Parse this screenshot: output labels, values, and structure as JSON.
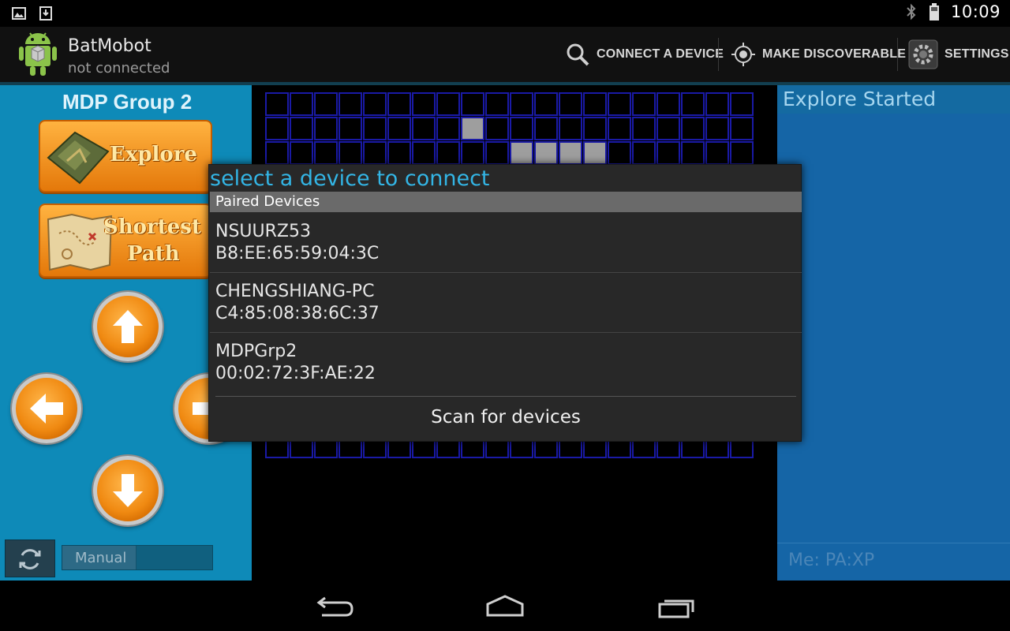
{
  "status_bar": {
    "clock": "10:09",
    "left_icons": [
      "gallery-notification-icon",
      "download-notification-icon"
    ],
    "right_icons": [
      "bluetooth-icon",
      "battery-icon"
    ]
  },
  "action_bar": {
    "title": "BatMobot",
    "subtitle": "not connected",
    "actions": {
      "connect": "CONNECT A DEVICE",
      "discoverable": "MAKE DISCOVERABLE",
      "settings": "SETTINGS"
    }
  },
  "left_panel": {
    "group_title": "MDP Group 2",
    "explore_label": "Explore",
    "shortest_label_line1": "Shortest",
    "shortest_label_line2": "Path",
    "mode_toggle_label": "Manual"
  },
  "maze": {
    "columns": 20,
    "visible_rows": 3,
    "explored_cells": [
      [
        1,
        8
      ],
      [
        2,
        10
      ],
      [
        2,
        11
      ],
      [
        2,
        12
      ],
      [
        2,
        13
      ]
    ],
    "cell_color_explored": "#9e9e9e",
    "grid_line_color": "#1a1aa6"
  },
  "right_panel": {
    "status": "Explore Started",
    "me_status": "Me:  PA:XP"
  },
  "dialog": {
    "title": "select a device to connect",
    "paired_header": "Paired Devices",
    "devices": [
      {
        "name": "NSUURZ53",
        "address": "B8:EE:65:59:04:3C"
      },
      {
        "name": "CHENGSHIANG-PC",
        "address": "C4:85:08:38:6C:37"
      },
      {
        "name": "MDPGrp2",
        "address": "00:02:72:3F:AE:22"
      }
    ],
    "scan_button": "Scan for devices"
  },
  "colors": {
    "accent": "#33b5e5",
    "left_panel": "#0e8ab8",
    "right_panel": "#1565a6",
    "button_orange": "#f08a12"
  }
}
